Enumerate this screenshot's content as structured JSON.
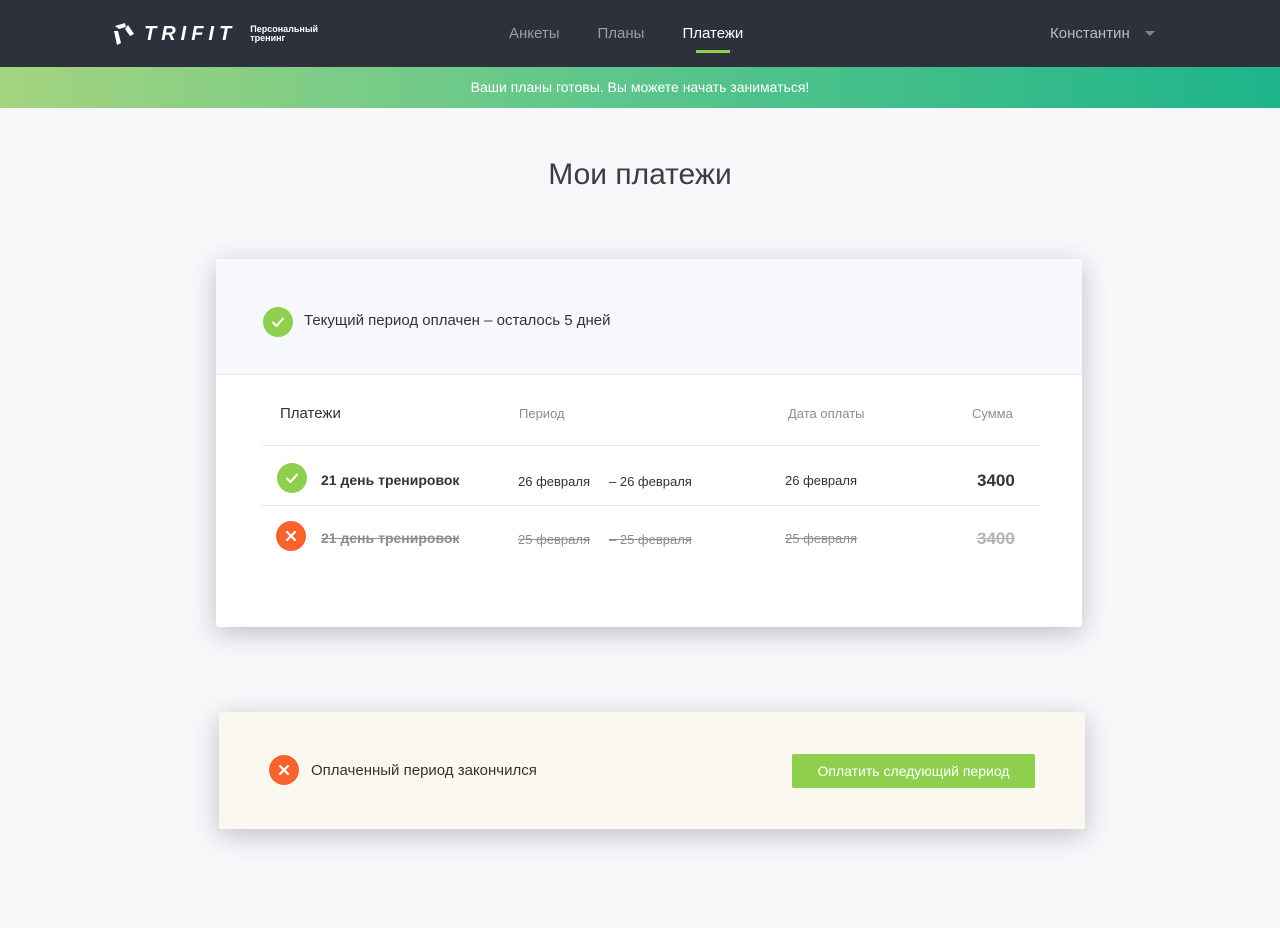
{
  "header": {
    "logo_text": "TRIFIT",
    "logo_tagline": "Персональный тренинг",
    "nav": [
      {
        "label": "Анкеты",
        "active": false
      },
      {
        "label": "Планы",
        "active": false
      },
      {
        "label": "Платежи",
        "active": true
      }
    ],
    "user_name": "Константин"
  },
  "banner": {
    "text": "Ваши планы готовы. Вы можете начать заниматься!"
  },
  "page_title": "Мои платежи",
  "payments_card": {
    "status_text": "Текущий период оплачен – осталось 5 дней",
    "columns": {
      "title": "Платежи",
      "period": "Период",
      "paid_date": "Дата оплаты",
      "amount": "Сумма"
    },
    "rows": [
      {
        "status": "ok",
        "name": "21 день тренировок",
        "period_start": "26 февраля",
        "period_end": "– 26 февраля",
        "paid_date": "26 февраля",
        "amount": "3400"
      },
      {
        "status": "cancelled",
        "name": "21 день тренировок",
        "period_start": "25 февраля",
        "period_end": "– 25 февраля",
        "paid_date": "25 февраля",
        "amount": "3400"
      }
    ]
  },
  "expired_card": {
    "text": "Оплаченный период закончился",
    "button_label": "Оплатить следующий период"
  },
  "colors": {
    "header_bg": "#2e313b",
    "accent_green": "#8ed04e",
    "error_orange": "#f7622d",
    "banner_start": "#a4d47f",
    "banner_end": "#1db48a"
  }
}
